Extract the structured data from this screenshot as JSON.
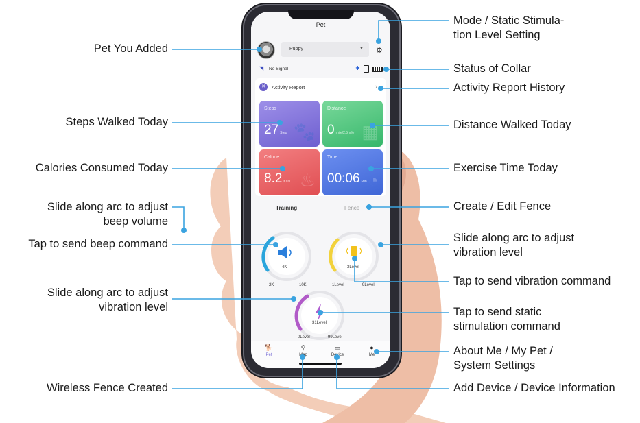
{
  "callouts": {
    "pet_you_added": "Pet You Added",
    "mode_static_level": "Mode / Static Stimula-\ntion Level Setting",
    "status_of_collar": "Status of Collar",
    "activity_report_history": "Activity Report History",
    "steps_walked_today": "Steps Walked Today",
    "distance_walked_today": "Distance Walked Today",
    "calories_consumed_today": "Calories Consumed Today",
    "exercise_time_today": "Exercise Time Today",
    "slide_beep_volume": "Slide along arc to adjust\nbeep volume",
    "create_edit_fence": "Create / Edit Fence",
    "tap_send_beep": "Tap to send beep command",
    "slide_vibration_right": "Slide along arc to adjust\nvibration level",
    "tap_send_vibration": "Tap to send vibration command",
    "slide_vibration_left": "Slide along arc to adjust\nvibration level",
    "tap_send_static": "Tap to send static\nstimulation command",
    "about_me": "About Me / My Pet /\nSystem Settings",
    "wireless_fence_created": "Wireless Fence Created",
    "add_device_info": "Add Device / Device Information"
  },
  "app": {
    "title": "Pet",
    "pet_name": "Puppy",
    "signal_status": "No Signal",
    "activity_report_title": "Activity Report",
    "tiles": {
      "steps": {
        "label": "Steps",
        "value": "27",
        "unit": "Step"
      },
      "distance": {
        "label": "Distance",
        "value": "0",
        "unit": "mile/2.5mile"
      },
      "calorie": {
        "label": "Calorie",
        "value": "8.2",
        "unit": "Kcal"
      },
      "time": {
        "label": "Time",
        "value": "00:06",
        "unit": "Min"
      }
    },
    "tabs": {
      "training": "Training",
      "fence": "Fence"
    },
    "beep_dial": {
      "center": "4K",
      "min": "2K",
      "max": "10K"
    },
    "vibration_dial": {
      "center": "3Level",
      "min": "1Level",
      "max": "9Level"
    },
    "static_dial": {
      "center": "31Level",
      "min": "0Level",
      "max": "99Level"
    },
    "nav": {
      "pet": "Pet",
      "map": "Map",
      "device": "Device",
      "me": "Me"
    }
  },
  "colors": {
    "callout_line": "#3aa3e0",
    "accent": "#6a5fc9",
    "beep_arc": "#2aa5dc",
    "vibration_arc": "#f2d23c",
    "static_arc": "#b15ac8"
  },
  "icons": {
    "gear": "gear-icon",
    "bluetooth": "bluetooth-icon",
    "battery": "battery-icon",
    "speaker": "speaker-icon",
    "vibration": "vibration-icon",
    "lightning": "lightning-icon"
  }
}
